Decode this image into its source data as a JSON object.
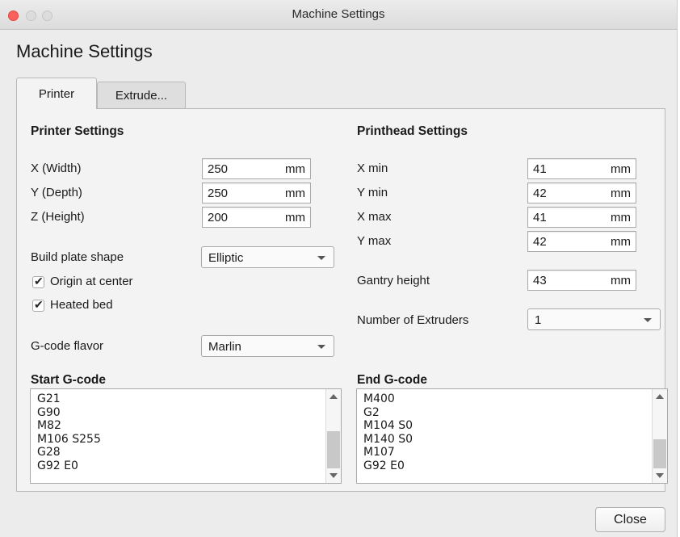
{
  "window": {
    "title": "Machine Settings"
  },
  "heading": "Machine Settings",
  "tabs": [
    {
      "label": "Printer",
      "active": true
    },
    {
      "label": "Extrude...",
      "active": false
    }
  ],
  "printer_settings": {
    "title": "Printer Settings",
    "x_width": {
      "label": "X (Width)",
      "value": "250",
      "unit": "mm"
    },
    "y_depth": {
      "label": "Y (Depth)",
      "value": "250",
      "unit": "mm"
    },
    "z_height": {
      "label": "Z (Height)",
      "value": "200",
      "unit": "mm"
    },
    "build_plate_shape": {
      "label": "Build plate shape",
      "value": "Elliptic"
    },
    "origin_at_center": {
      "label": "Origin at center",
      "checked": true
    },
    "heated_bed": {
      "label": "Heated bed",
      "checked": true
    },
    "gcode_flavor": {
      "label": "G-code flavor",
      "value": "Marlin"
    }
  },
  "printhead_settings": {
    "title": "Printhead Settings",
    "x_min": {
      "label": "X min",
      "value": "41",
      "unit": "mm"
    },
    "y_min": {
      "label": "Y min",
      "value": "42",
      "unit": "mm"
    },
    "x_max": {
      "label": "X max",
      "value": "41",
      "unit": "mm"
    },
    "y_max": {
      "label": "Y max",
      "value": "42",
      "unit": "mm"
    },
    "gantry_height": {
      "label": "Gantry height",
      "value": "43",
      "unit": "mm"
    },
    "number_of_extruders": {
      "label": "Number of Extruders",
      "value": "1"
    }
  },
  "start_gcode": {
    "title": "Start G-code",
    "lines": [
      "G21",
      "G90",
      "M82",
      "M106 S255",
      "G28",
      "G92 E0"
    ]
  },
  "end_gcode": {
    "title": "End G-code",
    "lines": [
      "M400",
      "G2",
      "M104 S0",
      "M140 S0",
      "M107",
      "G92 E0"
    ]
  },
  "buttons": {
    "close": "Close"
  },
  "icons": {
    "check": "checkmark-icon",
    "dropdown": "chevron-down-icon"
  },
  "colors": {
    "close_light": "#fc605c",
    "window_bg": "#ececec",
    "panel_bg": "#f3f3f3"
  }
}
